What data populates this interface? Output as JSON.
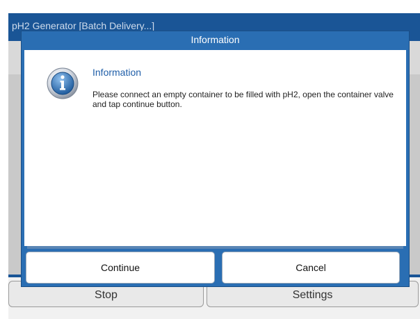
{
  "app": {
    "title": "pH2 Generator  [Batch Delivery...]",
    "buttons": {
      "stop": "Stop",
      "settings": "Settings"
    }
  },
  "dialog": {
    "title": "Information",
    "icon": "info-icon",
    "heading": "Information",
    "message": "Please connect an empty container to be filled with pH2, open the container valve and tap continue button.",
    "buttons": {
      "continue": "Continue",
      "cancel": "Cancel"
    }
  },
  "colors": {
    "titlebar": "#1a5596",
    "dialog_frame": "#2a6eb3",
    "heading_text": "#1f5ea8"
  }
}
